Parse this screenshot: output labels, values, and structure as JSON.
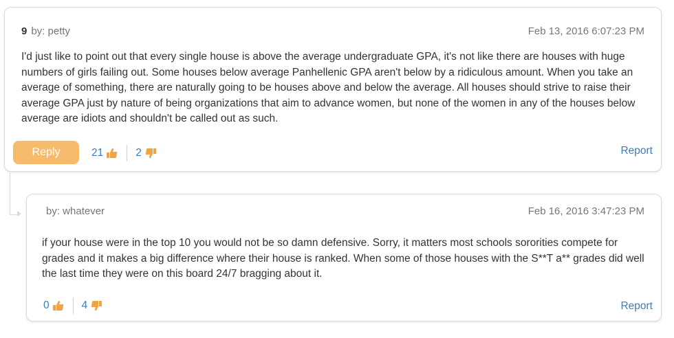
{
  "colors": {
    "accent_button": "#f7bb6c",
    "link_blue": "#3a7cb5",
    "thumb_orange": "#f0a444"
  },
  "comment": {
    "number": "9",
    "author": "by: petty",
    "date": "Feb 13, 2016 6:07:23 PM",
    "text": "I'd just like to point out that every single house is above the average undergraduate GPA, it's not like there are houses with huge numbers of girls failing out. Some houses below average Panhellenic GPA aren't below by a ridiculous amount. When you take an average of something, there are naturally going to be houses above and below the average. All houses should strive to raise their average GPA just by nature of being organizations that aim to advance women, but none of the women in any of the houses below average are idiots and shouldn't be called out as such.",
    "reply_label": "Reply",
    "upvotes": "21",
    "downvotes": "2",
    "report_label": "Report",
    "icons": {
      "up": "thumbs-up-icon",
      "down": "thumbs-down-icon"
    }
  },
  "reply": {
    "author": "by: whatever",
    "date": "Feb 16, 2016 3:47:23 PM",
    "text": "if your house were in the top 10 you would not be so damn defensive. Sorry, it matters most schools sororities compete for grades and it makes a big difference where their house is ranked. When some of those houses with the S**T a** grades did well the last time they were on this board 24/7 bragging about it.",
    "upvotes": "0",
    "downvotes": "4",
    "report_label": "Report"
  }
}
